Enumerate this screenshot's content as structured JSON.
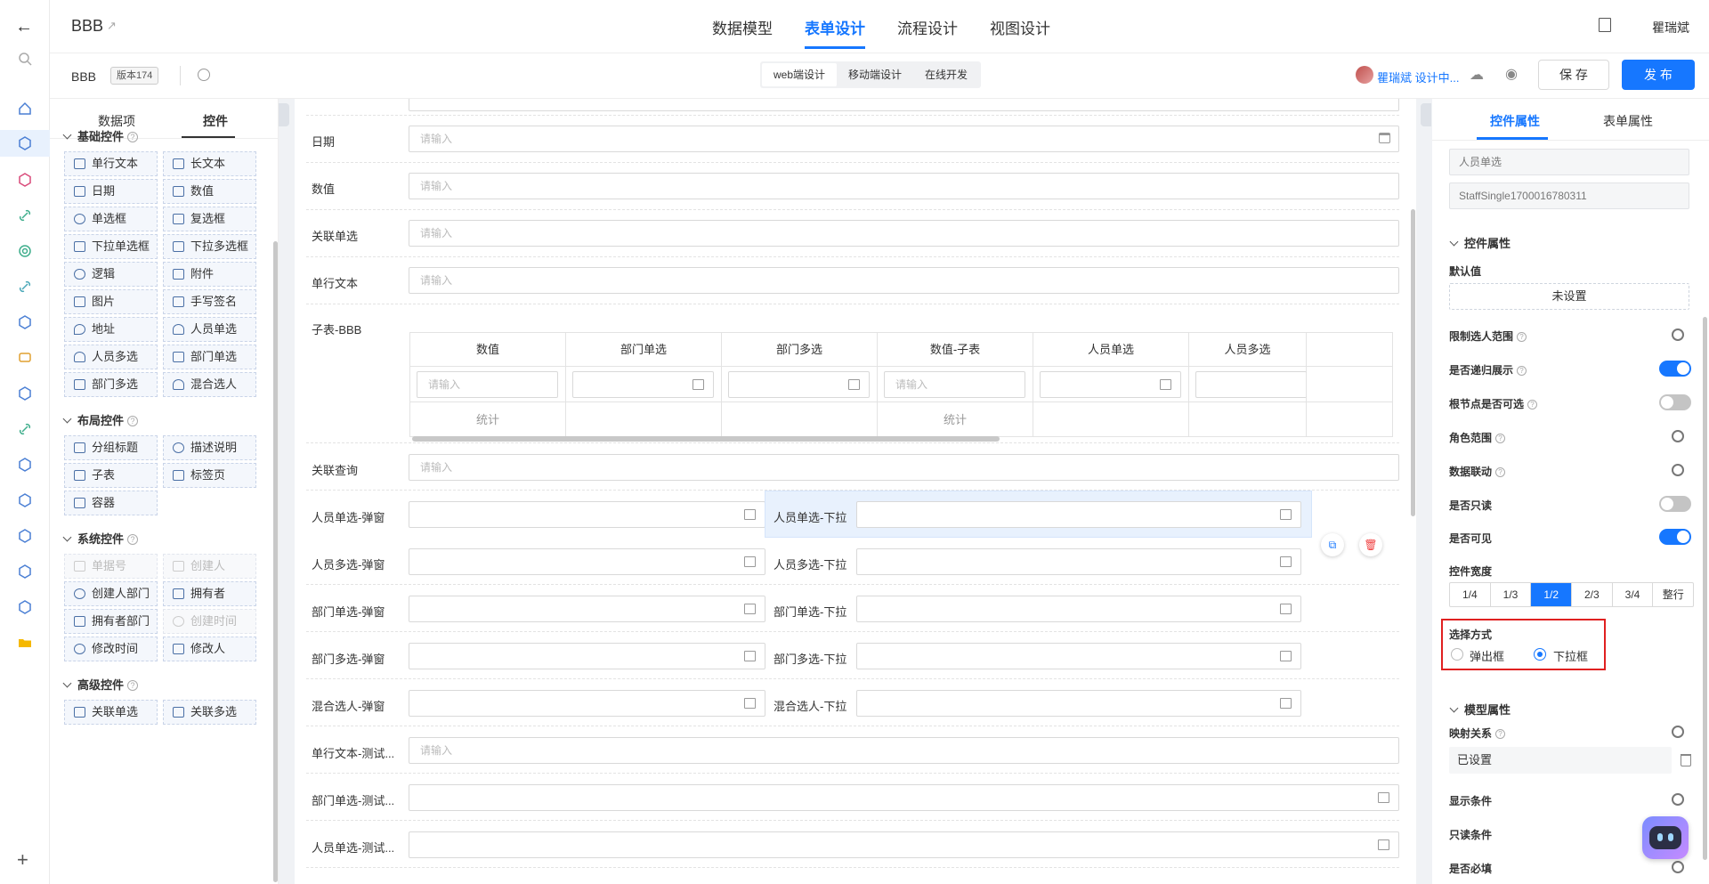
{
  "app": {
    "title": "BBB",
    "user": "瞿瑞斌"
  },
  "main_tabs": [
    {
      "label": "数据模型"
    },
    {
      "label": "表单设计"
    },
    {
      "label": "流程设计"
    },
    {
      "label": "视图设计"
    }
  ],
  "subbar": {
    "form_name": "BBB",
    "version": "版本174",
    "modes": [
      "web端设计",
      "移动端设计",
      "在线开发"
    ],
    "online_user": "瞿瑞斌 设计中...",
    "save_label": "保 存",
    "publish_label": "发 布"
  },
  "palette": {
    "tabs": [
      "数据项",
      "控件"
    ],
    "groups": {
      "basic": {
        "title": "基础控件",
        "items": [
          "单行文本",
          "长文本",
          "日期",
          "数值",
          "单选框",
          "复选框",
          "下拉单选框",
          "下拉多选框",
          "逻辑",
          "附件",
          "图片",
          "手写签名",
          "地址",
          "人员单选",
          "人员多选",
          "部门单选",
          "部门多选",
          "混合选人"
        ]
      },
      "layout": {
        "title": "布局控件",
        "items": [
          "分组标题",
          "描述说明",
          "子表",
          "标签页",
          "容器"
        ]
      },
      "system": {
        "title": "系统控件",
        "items": [
          "单据号",
          "创建人",
          "创建人部门",
          "拥有者",
          "拥有者部门",
          "创建时间",
          "修改时间",
          "修改人"
        ]
      },
      "advanced": {
        "title": "高级控件",
        "items": [
          "关联单选",
          "关联多选"
        ]
      }
    }
  },
  "form": {
    "placeholder": "请输入",
    "rows": {
      "date": "日期",
      "number": "数值",
      "rel_single": "关联单选",
      "single_text": "单行文本",
      "subtable": "子表-BBB",
      "rel_query": "关联查询",
      "staff_single_popup": "人员单选-弹窗",
      "staff_single_dropdown": "人员单选-下拉",
      "staff_multi_popup": "人员多选-弹窗",
      "staff_multi_dropdown": "人员多选-下拉",
      "dept_single_popup": "部门单选-弹窗",
      "dept_single_dropdown": "部门单选-下拉",
      "dept_multi_popup": "部门多选-弹窗",
      "dept_multi_dropdown": "部门多选-下拉",
      "mixed_popup": "混合选人-弹窗",
      "mixed_dropdown": "混合选人-下拉",
      "text_test": "单行文本-测试...",
      "dept_test": "部门单选-测试...",
      "staff_test": "人员单选-测试..."
    },
    "subtable": {
      "columns": [
        "数值",
        "部门单选",
        "部门多选",
        "数值-子表",
        "人员单选",
        "人员多选"
      ],
      "summary": "统计"
    }
  },
  "props": {
    "tabs": [
      "控件属性",
      "表单属性"
    ],
    "field_name": "人员单选",
    "field_code": "StaffSingle1700016780311",
    "section_control": "控件属性",
    "default_label": "默认值",
    "default_value": "未设置",
    "labels": {
      "scope": "限制选人范围",
      "recursive": "是否递归展示",
      "root_select": "根节点是否可选",
      "role_scope": "角色范围",
      "linkage": "数据联动",
      "readonly": "是否只读",
      "visible": "是否可见",
      "width": "控件宽度"
    },
    "toggles": {
      "recursive": true,
      "root_select": false,
      "readonly": false,
      "visible": true
    },
    "width_options": [
      "1/4",
      "1/3",
      "1/2",
      "2/3",
      "3/4",
      "整行"
    ],
    "width_selected": "1/2",
    "select_mode": {
      "label": "选择方式",
      "options": [
        "弹出框",
        "下拉框"
      ],
      "selected": "下拉框"
    },
    "section_model": "模型属性",
    "mapping_label": "映射关系",
    "mapping_value": "已设置",
    "display_cond": "显示条件",
    "readonly_cond": "只读条件",
    "required": "是否必填"
  }
}
